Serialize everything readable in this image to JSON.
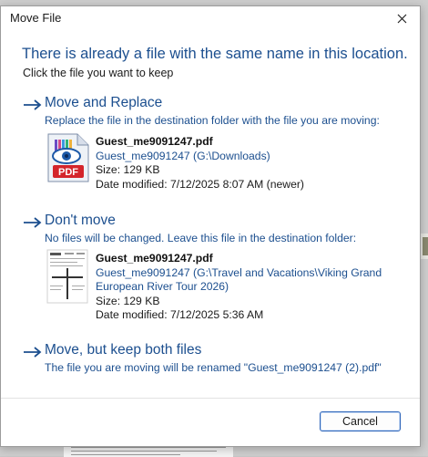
{
  "dialog": {
    "title": "Move File",
    "headline": "There is already a file with the same name in this location.",
    "subhead": "Click the file you want to keep",
    "cancel_label": "Cancel"
  },
  "options": [
    {
      "title": "Move and Replace",
      "description": "Replace the file in the destination folder with the file you are moving:",
      "file": {
        "name": "Guest_me9091247.pdf",
        "location": "Guest_me9091247 (G:\\Downloads)",
        "size": "Size: 129 KB",
        "modified": "Date modified: 7/12/2025 8:07 AM (newer)"
      }
    },
    {
      "title": "Don't move",
      "description": "No files will be changed. Leave this file in the destination folder:",
      "file": {
        "name": "Guest_me9091247.pdf",
        "location_line1": "Guest_me9091247 (G:\\Travel and Vacations\\Viking Grand",
        "location_line2": "European River Tour 2026)",
        "size": "Size: 129 KB",
        "modified": "Date modified: 7/12/2025 5:36 AM"
      }
    },
    {
      "title": "Move, but keep both files",
      "description": "The file you are moving will be renamed \"Guest_me9091247 (2).pdf\""
    }
  ],
  "icons": {
    "close": "close-icon",
    "arrow": "arrow-right-icon",
    "pdf": "pdf-file-icon",
    "thumbnail": "document-thumbnail-icon"
  },
  "colors": {
    "accent_text": "#1c4f8f",
    "button_border": "#2a62b8"
  }
}
